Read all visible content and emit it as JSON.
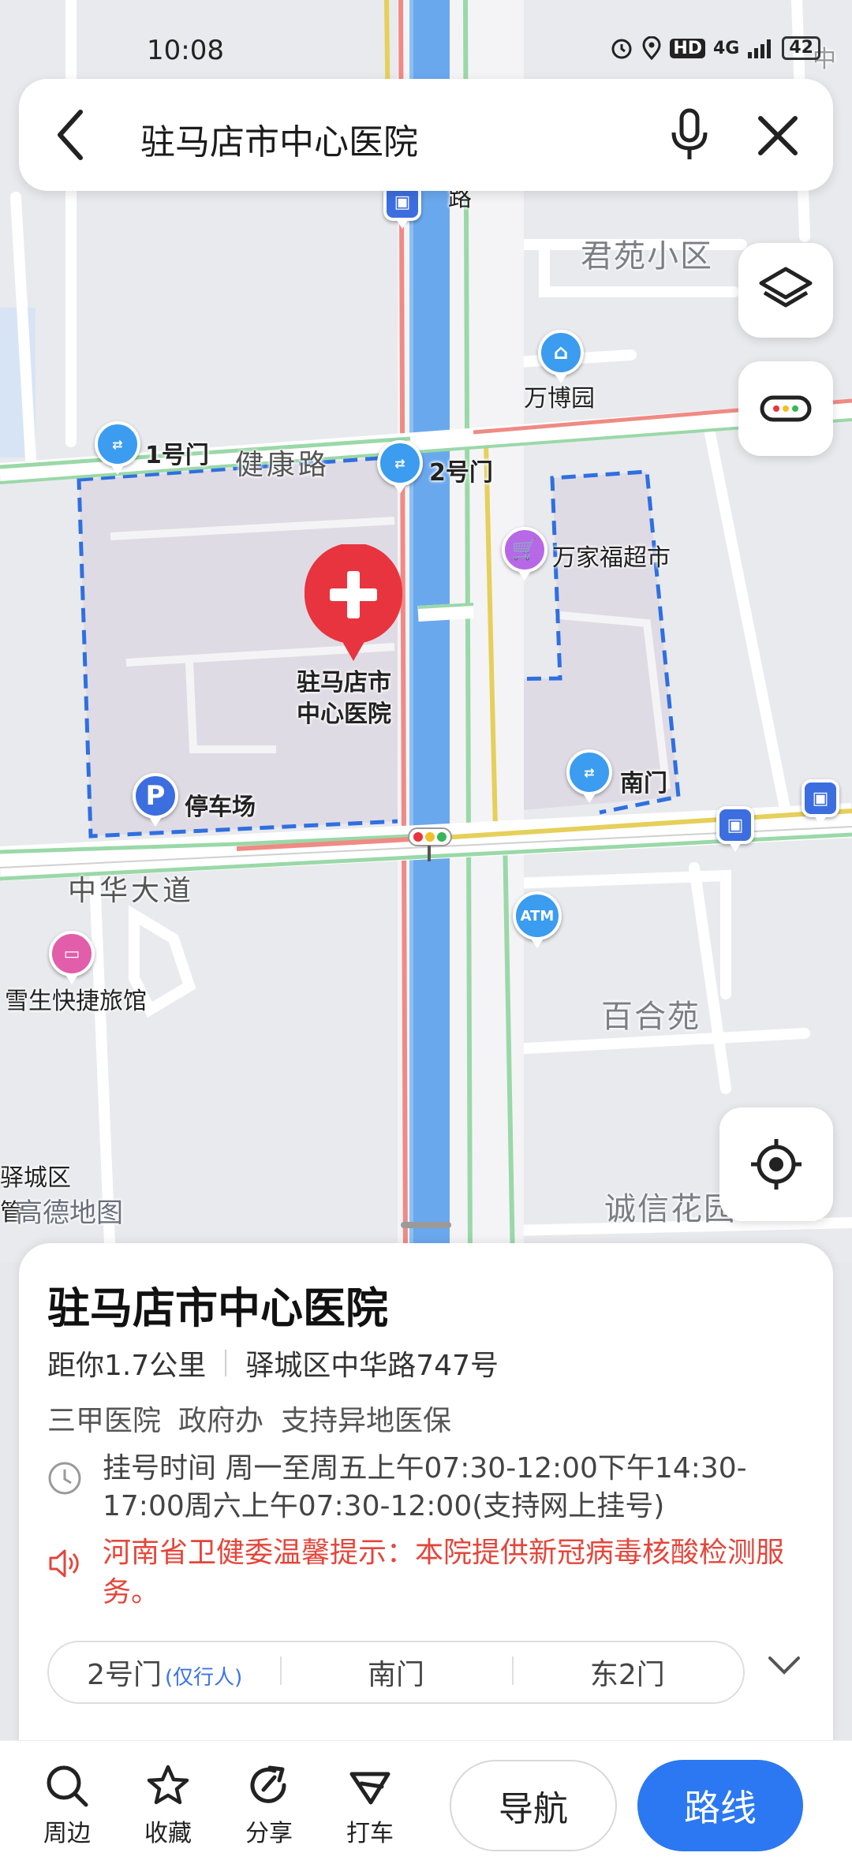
{
  "status_bar": {
    "time": "10:08",
    "network": "4G",
    "hd": "HD",
    "battery": "42"
  },
  "search": {
    "query": "驻马店市中心医院"
  },
  "map": {
    "labels": {
      "junyuan": "君苑小区",
      "wanboyuan": "万博园",
      "gate1": "1号门",
      "jiankang_road": "健康路",
      "gate2": "2号门",
      "wanjiafu": "万家福超市",
      "hospital": "驻马店市\n中心医院",
      "hospital_line1": "驻马店市",
      "hospital_line2": "中心医院",
      "south_gate": "南门",
      "parking": "停车场",
      "zhonghua_avenue": "中华大道",
      "xuesheng_hotel": "雪生快捷旅馆",
      "baiheyuan": "百合苑",
      "yicheng": "驿城区",
      "chengxin": "诚信花园",
      "guan": "管",
      "road_top": "路",
      "corner_top": "中",
      "atm": "ATM",
      "watermark": "高德地图"
    },
    "colors": {
      "hospital_red": "#e8343e",
      "river": "#6aa8ee",
      "main_road_pink": "#f08a84",
      "road_green": "#9ad8a8",
      "road_yellow": "#e6cf5a",
      "boundary_blue": "#2f6fe0"
    }
  },
  "sheet": {
    "title": "驻马店市中心医院",
    "distance": "距你1.7公里",
    "address": "驿城区中华路747号",
    "tags": [
      "三甲医院",
      "政府办",
      "支持异地医保"
    ],
    "hours": "挂号时间 周一至周五上午07:30-12:00下午14:30-17:00周六上午07:30-12:00(支持网上挂号)",
    "notice": "河南省卫健委温馨提示：本院提供新冠病毒核酸检测服务。",
    "gates": [
      {
        "label": "2号门",
        "note": "(仅行人)"
      },
      {
        "label": "南门",
        "note": ""
      },
      {
        "label": "东2门",
        "note": ""
      }
    ]
  },
  "toolbar": {
    "nearby": "周边",
    "favorite": "收藏",
    "share": "分享",
    "taxi": "打车",
    "navigate": "导航",
    "route": "路线"
  }
}
